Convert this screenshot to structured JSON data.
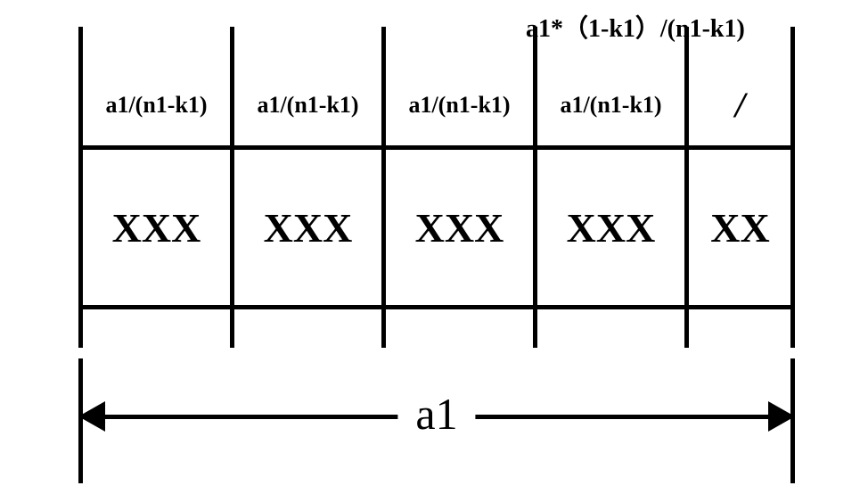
{
  "top_label": "a1*（1-k1）/(n1-k1)",
  "columns": {
    "widths": [
      170,
      170,
      170,
      170,
      120
    ],
    "headers": [
      "a1/(n1-k1)",
      "a1/(n1-k1)",
      "a1/(n1-k1)",
      "a1/(n1-k1)",
      "/"
    ],
    "bodies": [
      "XXX",
      "XXX",
      "XXX",
      "XXX",
      "XX"
    ]
  },
  "total_label": "a1"
}
